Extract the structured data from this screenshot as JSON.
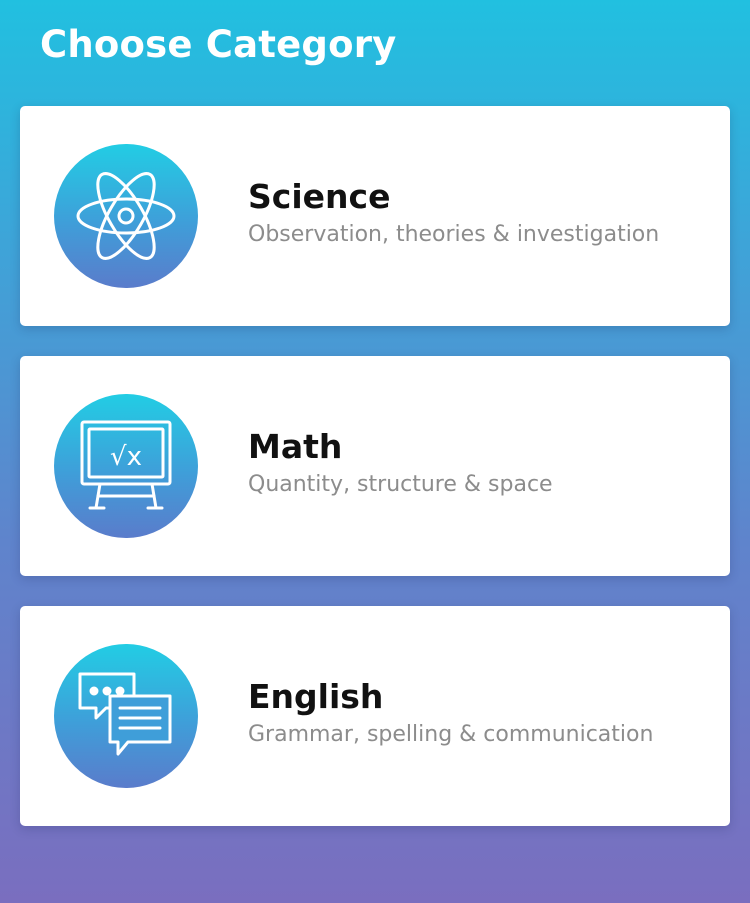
{
  "header": {
    "title": "Choose Category"
  },
  "categories": [
    {
      "title": "Science",
      "subtitle": "Observation, theories & investigation",
      "icon": "atom-icon"
    },
    {
      "title": "Math",
      "subtitle": "Quantity, structure & space",
      "icon": "math-board-icon"
    },
    {
      "title": "English",
      "subtitle": "Grammar, spelling & communication",
      "icon": "chat-bubbles-icon"
    }
  ],
  "math_icon_text": "√x"
}
